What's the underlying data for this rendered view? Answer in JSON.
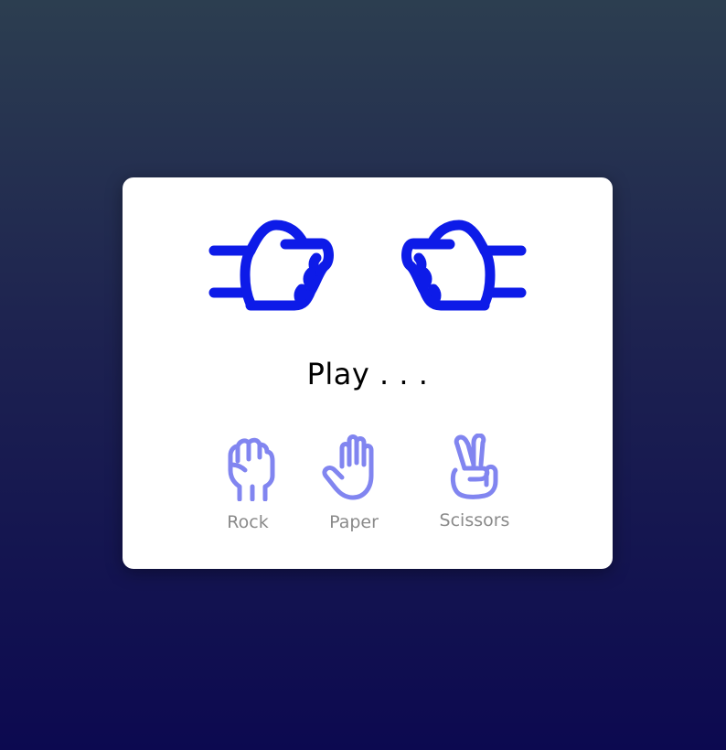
{
  "result_text": "Play . . .",
  "colors": {
    "hand_stroke": "#0d1be8",
    "choice_icon": "#8185f0",
    "label": "#8a8a8a"
  },
  "player_hand": {
    "icon": "fist-pointing-right-icon"
  },
  "computer_hand": {
    "icon": "fist-pointing-left-icon"
  },
  "choices": [
    {
      "label": "Rock",
      "icon": "rock-hand-icon"
    },
    {
      "label": "Paper",
      "icon": "paper-hand-icon"
    },
    {
      "label": "Scissors",
      "icon": "scissors-hand-icon"
    }
  ]
}
